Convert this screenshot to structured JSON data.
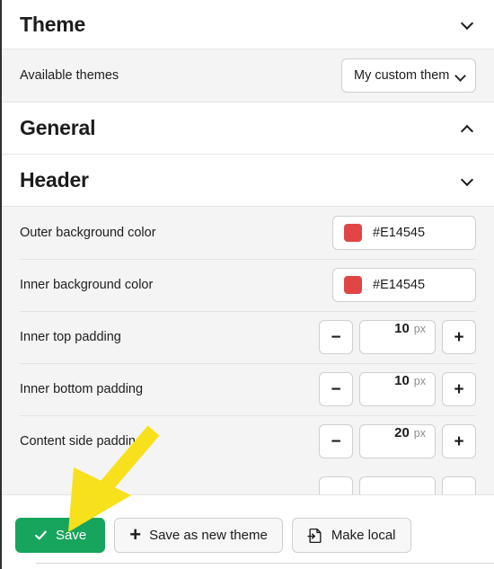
{
  "panel": {
    "sections": [
      {
        "id": "theme",
        "title": "Theme",
        "chevron": "chevron-down-icon",
        "expanded": true
      },
      {
        "id": "general",
        "title": "General",
        "chevron": "chevron-up-icon",
        "expanded": false
      },
      {
        "id": "header",
        "title": "Header",
        "chevron": "chevron-down-icon",
        "expanded": true
      }
    ],
    "theme_settings": {
      "available_themes": {
        "label": "Available themes",
        "selected": "My custom theme",
        "chevron": "chevron-down-icon"
      }
    },
    "header_settings": {
      "outer_background_color": {
        "label": "Outer background color",
        "value": "#E14545",
        "swatch": "#E14545"
      },
      "inner_background_color": {
        "label": "Inner background color",
        "value": "#E14545",
        "swatch": "#E14545"
      },
      "inner_top_padding": {
        "label": "Inner top padding",
        "value": "10",
        "unit": "px",
        "decrement": "−",
        "increment": "+"
      },
      "inner_bottom_padding": {
        "label": "Inner bottom padding",
        "value": "10",
        "unit": "px",
        "decrement": "−",
        "increment": "+"
      },
      "content_side_padding": {
        "label": "Content side padding",
        "value": "20",
        "unit": "px",
        "decrement": "−",
        "increment": "+"
      }
    }
  },
  "footer": {
    "save": {
      "label": "Save",
      "icon": "check-icon",
      "color": "#17A45C"
    },
    "save_as_new_theme": {
      "label": "Save as new theme",
      "icon": "plus-icon"
    },
    "make_local": {
      "label": "Make local",
      "icon": "file-import-icon"
    }
  },
  "annotation": {
    "arrow": {
      "color": "#F7E01C",
      "points_to": "save-button"
    }
  }
}
